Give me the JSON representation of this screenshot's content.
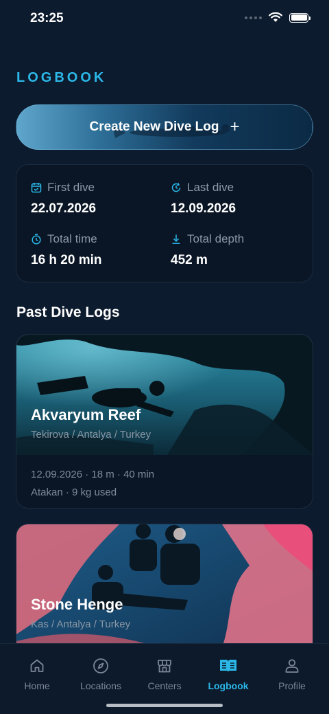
{
  "status": {
    "time": "23:25"
  },
  "page": {
    "title": "LOGBOOK"
  },
  "create_button": {
    "label": "Create New Dive Log",
    "icon": "plus-icon"
  },
  "stats": {
    "first_dive": {
      "label": "First dive",
      "value": "22.07.2026",
      "icon": "calendar-icon"
    },
    "last_dive": {
      "label": "Last dive",
      "value": "12.09.2026",
      "icon": "history-icon"
    },
    "total_time": {
      "label": "Total time",
      "value": "16 h 20 min",
      "icon": "timer-icon"
    },
    "total_depth": {
      "label": "Total depth",
      "value": "452 m",
      "icon": "depth-icon"
    }
  },
  "past_logs": {
    "title": "Past Dive Logs",
    "items": [
      {
        "name": "Akvaryum Reef",
        "location": "Tekirova / Antalya / Turkey",
        "summary": "12.09.2026 · 18 m · 40 min",
        "details": "Atakan · 9 kg used"
      },
      {
        "name": "Stone Henge",
        "location": "Kas / Antalya / Turkey"
      }
    ]
  },
  "tabs": [
    {
      "label": "Home",
      "icon": "home-icon",
      "active": false
    },
    {
      "label": "Locations",
      "icon": "compass-icon",
      "active": false
    },
    {
      "label": "Centers",
      "icon": "storefront-icon",
      "active": false
    },
    {
      "label": "Logbook",
      "icon": "book-icon",
      "active": true
    },
    {
      "label": "Profile",
      "icon": "person-icon",
      "active": false
    }
  ],
  "colors": {
    "accent": "#2bb8e8",
    "background": "#0d1b2e",
    "card": "#0a1626"
  }
}
